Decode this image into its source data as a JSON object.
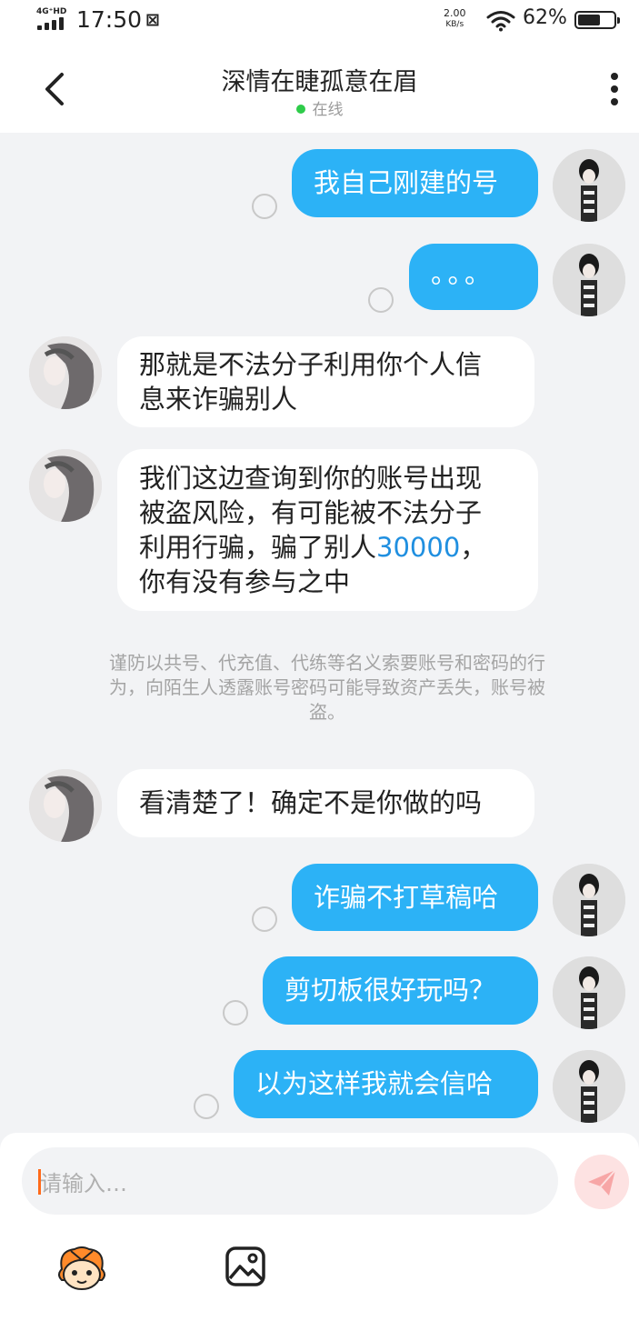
{
  "status_bar": {
    "network": "4G⁺HD",
    "time": "17:50",
    "speed_value": "2.00",
    "speed_unit": "KB/s",
    "battery_percent": "62%",
    "battery_level": 0.62
  },
  "header": {
    "title": "深情在睫孤意在眉",
    "presence": "在线"
  },
  "messages": [
    {
      "side": "out",
      "text": "我自己刚建的号"
    },
    {
      "side": "out",
      "text": "。。。"
    },
    {
      "side": "in",
      "lines": [
        "那就是不法分子利用你个人信",
        "息来诈骗别人"
      ]
    },
    {
      "side": "in",
      "lines": [
        "我们这边查询到你的账号出现",
        "被盗风险，有可能被不法分子",
        "利用行骗，骗了别人"
      ],
      "amount": "30000",
      "after_amount": "，",
      "last_line": "你有没有参与之中"
    },
    {
      "side": "in",
      "text": "看清楚了！确定不是你做的吗"
    },
    {
      "side": "out",
      "text": "诈骗不打草稿哈"
    },
    {
      "side": "out",
      "text": "剪切板很好玩吗？"
    },
    {
      "side": "out",
      "text": "以为这样我就会信哈"
    }
  ],
  "notice": {
    "lines": [
      "谨防以共号、代充值、代练等名义索要账号和密码的行",
      "为，向陌生人透露账号密码可能导致资产丢失，账号被",
      "盗。"
    ]
  },
  "composer": {
    "placeholder": "请输入…"
  },
  "colors": {
    "outgoing_bubble": "#2cb2f6",
    "online_dot": "#2ecc4a",
    "background": "#f2f3f5"
  },
  "icons": [
    "back-arrow-icon",
    "more-vertical-icon",
    "wifi-icon",
    "battery-icon",
    "send-icon",
    "emoji-icon",
    "image-icon"
  ]
}
